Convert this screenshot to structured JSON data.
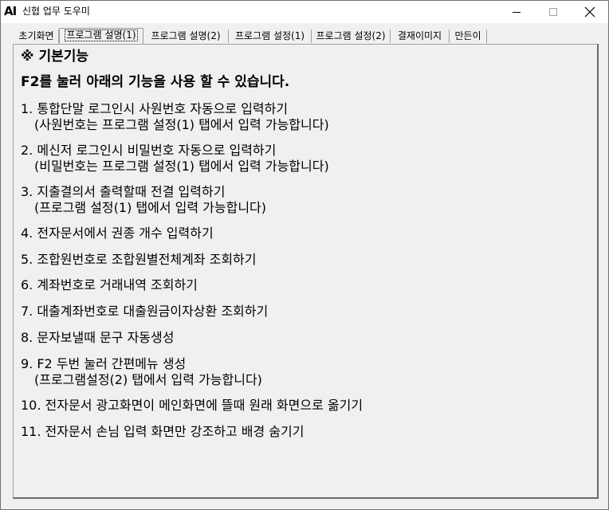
{
  "window": {
    "icon_text": "AI",
    "title": "신협 업무 도우미"
  },
  "tabs": [
    {
      "label": "초기화면",
      "selected": false
    },
    {
      "label": "프로그램 설명(1)",
      "selected": true
    },
    {
      "label": "프로그램 설명(2)",
      "selected": false
    },
    {
      "label": "프로그램 설정(1)",
      "selected": false
    },
    {
      "label": "프로그램 설정(2)",
      "selected": false
    },
    {
      "label": "결재이미지",
      "selected": false
    },
    {
      "label": "만든이",
      "selected": false
    }
  ],
  "main": {
    "heading": "※ 기본기능",
    "intro": "F2를 눌러 아래의 기능을 사용 할 수 있습니다.",
    "items": [
      {
        "text": "1. 통합단말 로그인시 사원번호 자동으로 입력하기",
        "note": "(사원번호는 프로그램 설정(1) 탭에서 입력 가능합니다)"
      },
      {
        "text": "2. 메신저 로그인시 비밀번호 자동으로 입력하기",
        "note": "(비밀번호는 프로그램 설정(1) 탭에서 입력 가능합니다)"
      },
      {
        "text": "3. 지출결의서 출력할때 전결 입력하기",
        "note": "(프로그램 설정(1) 탭에서 입력 가능합니다)"
      },
      {
        "text": "4. 전자문서에서 권종 개수 입력하기"
      },
      {
        "text": "5. 조합원번호로 조합원별전체계좌 조회하기"
      },
      {
        "text": "6. 계좌번호로 거래내역 조회하기"
      },
      {
        "text": "7. 대출계좌번호로 대출원금이자상환 조회하기"
      },
      {
        "text": "8. 문자보낼때 문구 자동생성"
      },
      {
        "text": "9. F2 두번 눌러 간편메뉴 생성",
        "note": "(프로그램설정(2) 탭에서 입력 가능합니다)"
      },
      {
        "text": "10. 전자문서 광고화면이 메인화면에 뜰때 원래 화면으로 옮기기"
      },
      {
        "text": "11. 전자문서 손님 입력 화면만 강조하고 배경 숨기기"
      }
    ]
  }
}
